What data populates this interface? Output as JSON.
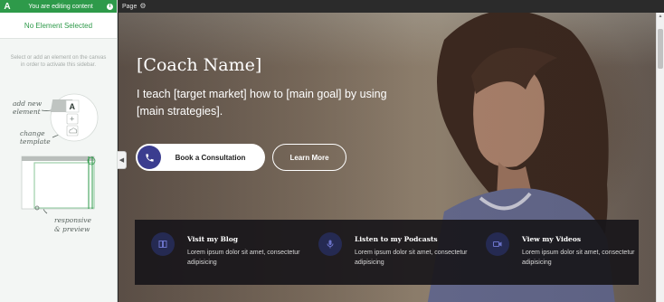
{
  "app": {
    "logo_letter": "A",
    "editing_text": "You are editing content",
    "info_icon": "i"
  },
  "sidebar": {
    "selected_text": "No Element Selected",
    "help_text": "Select or add an element on the canvas in order to activate this sidebar.",
    "illustration": {
      "add_new_element": [
        "add new",
        "element"
      ],
      "change_template": [
        "change",
        "template"
      ],
      "responsive_preview": [
        "responsive",
        "& preview"
      ]
    }
  },
  "toolbar": {
    "page_label": "Page",
    "gear_icon": "⚙"
  },
  "hero": {
    "coach_name": "[Coach Name]",
    "tagline": "I teach [target market] how to [main goal] by using [main strategies].",
    "book_button": "Book a Consultation",
    "learn_button": "Learn More"
  },
  "features": [
    {
      "title": "Visit my Blog",
      "desc": "Lorem ipsum dolor sit amet, consectetur adipisicing",
      "icon": "book-icon"
    },
    {
      "title": "Listen to my Podcasts",
      "desc": "Lorem ipsum dolor sit amet, consectetur adipisicing",
      "icon": "microphone-icon"
    },
    {
      "title": "View my Videos",
      "desc": "Lorem ipsum dolor sit amet, consectetur adipisicing",
      "icon": "video-icon"
    }
  ],
  "colors": {
    "accent_green": "#2e9a4a",
    "button_icon_navy": "#3b3d8f",
    "feature_icon_bg": "#252a52"
  },
  "collapse_icon": "◀"
}
